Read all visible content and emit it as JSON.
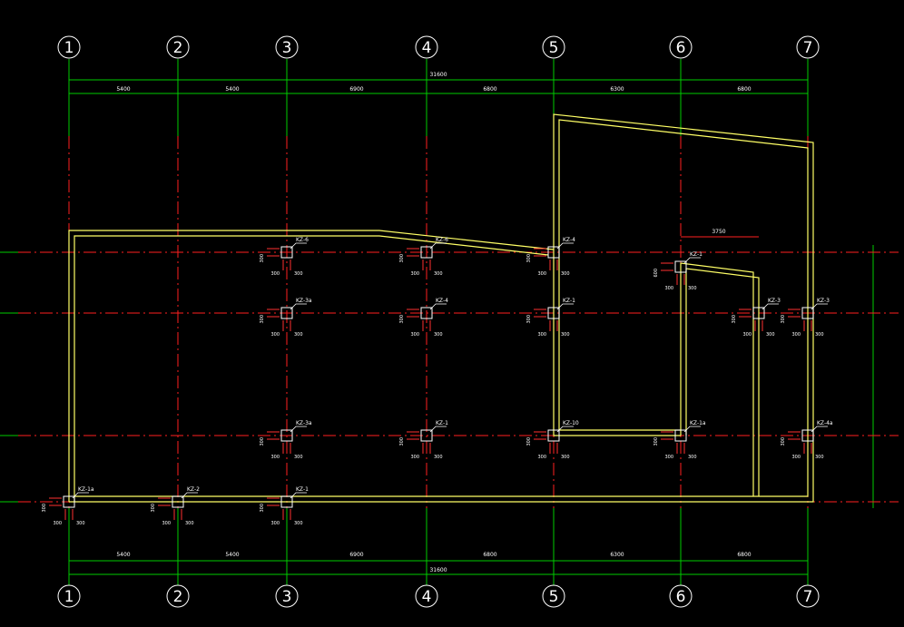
{
  "axes": [
    {
      "id": "1",
      "label": "1"
    },
    {
      "id": "2",
      "label": "2"
    },
    {
      "id": "3",
      "label": "3"
    },
    {
      "id": "4",
      "label": "4"
    },
    {
      "id": "5",
      "label": "5"
    },
    {
      "id": "6",
      "label": "6"
    },
    {
      "id": "7",
      "label": "7"
    }
  ],
  "dimensions": {
    "total": "31600",
    "spans": [
      "5400",
      "5400",
      "6900",
      "6800",
      "6300",
      "6800"
    ]
  },
  "extra_dimension": "3750",
  "columns": [
    {
      "label": "KZ-6",
      "dim_a": "300",
      "dim_b": "300",
      "dim_c": "300"
    },
    {
      "label": "KZ-6",
      "dim_a": "300",
      "dim_b": "300",
      "dim_c": "300"
    },
    {
      "label": "KZ-4",
      "dim_a": "300",
      "dim_b": "300",
      "dim_c": "300"
    },
    {
      "label": "KZ-1",
      "dim_a": "600",
      "dim_b": "300",
      "dim_c": "300"
    },
    {
      "label": "KZ-3a",
      "dim_a": "300",
      "dim_b": "300",
      "dim_c": "300"
    },
    {
      "label": "KZ-4",
      "dim_a": "300",
      "dim_b": "300",
      "dim_c": "300"
    },
    {
      "label": "KZ-1",
      "dim_a": "300",
      "dim_b": "300",
      "dim_c": "300"
    },
    {
      "label": "KZ-3",
      "dim_a": "300",
      "dim_b": "300",
      "dim_c": "300"
    },
    {
      "label": "KZ-3",
      "dim_a": "300",
      "dim_b": "300",
      "dim_c": "300"
    },
    {
      "label": "KZ-3a",
      "dim_a": "300",
      "dim_b": "300",
      "dim_c": "300"
    },
    {
      "label": "KZ-1",
      "dim_a": "300",
      "dim_b": "300",
      "dim_c": "300"
    },
    {
      "label": "KZ-10",
      "dim_a": "300",
      "dim_b": "300",
      "dim_c": "300"
    },
    {
      "label": "KZ-1a",
      "dim_a": "300",
      "dim_b": "300",
      "dim_c": "300"
    },
    {
      "label": "KZ-4a",
      "dim_a": "300",
      "dim_b": "300",
      "dim_c": "300"
    },
    {
      "label": "KZ-1a",
      "dim_a": "300",
      "dim_b": "300",
      "dim_c": "300"
    },
    {
      "label": "KZ-2",
      "dim_a": "300",
      "dim_b": "300",
      "dim_c": "300"
    },
    {
      "label": "KZ-1",
      "dim_a": "300",
      "dim_b": "300",
      "dim_c": "300"
    }
  ],
  "colors": {
    "background": "#000000",
    "axis_line": "#00ff00",
    "center_line": "#ff2020",
    "wall": "#ffff66",
    "column": "#ffffff",
    "dim_mark": "#ff3030"
  }
}
